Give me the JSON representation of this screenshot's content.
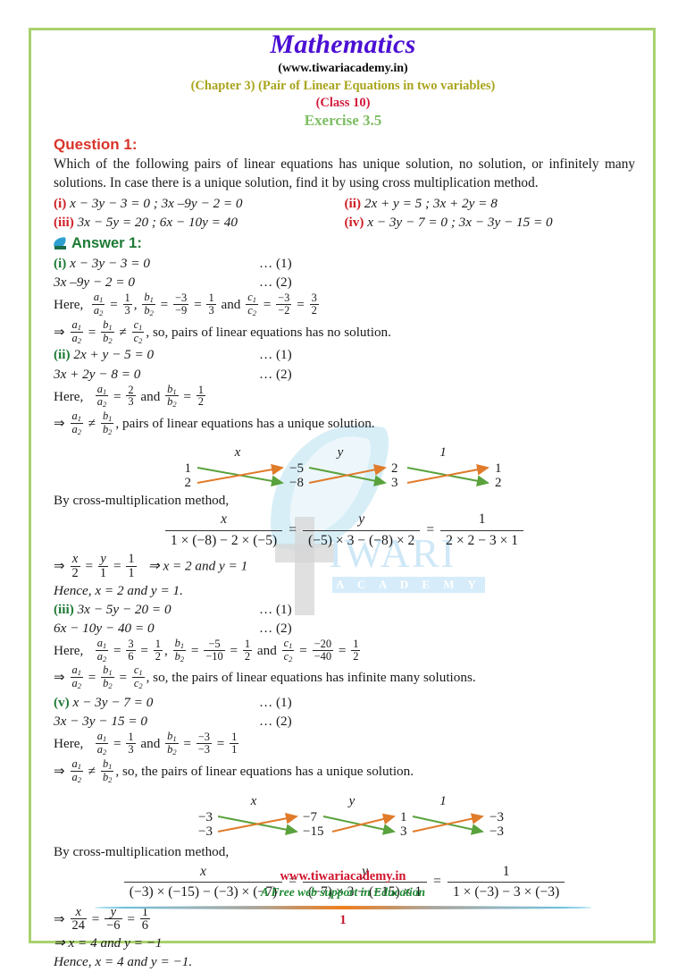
{
  "header": {
    "title": "Mathematics",
    "site": "(www.tiwariacademy.in)",
    "chapter": "(Chapter 3) (Pair of Linear Equations in two variables)",
    "class": "(Class 10)",
    "exercise": "Exercise 3.5"
  },
  "colors": {
    "title_purple": "#4b0fd4",
    "chapter_olive": "#a9a41d",
    "class_crimson": "#d21c3c",
    "exercise_green": "#7dbd63",
    "question_red": "#d9342b",
    "label_red": "#cf2027",
    "label_green": "#1e7a35",
    "border_green": "#a8d26d",
    "arrow_green": "#5aa23c",
    "arrow_orange": "#e07b2a",
    "watermark_blue": "#cfe8f7"
  },
  "question": {
    "heading": "Question 1:",
    "text": "Which of the following pairs of linear equations has unique solution, no solution, or infinitely many solutions. In case there is a unique solution, find it by using cross multiplication method.",
    "items": [
      {
        "label": "(i)",
        "equation": "x − 3y − 3  = 0 ; 3x –9y − 2  = 0"
      },
      {
        "label": "(ii)",
        "equation": "2x + y = 5 ; 3x + 2y = 8"
      },
      {
        "label": "(iii)",
        "equation": "3x − 5y = 20 ;   6x − 10y = 40"
      },
      {
        "label": "(iv)",
        "equation": "x − 3y − 7 = 0 ; 3x − 3y − 15 = 0"
      }
    ]
  },
  "answer": {
    "heading": "Answer 1:",
    "icon": "feather-pen-icon"
  },
  "part_i": {
    "label": "(i)",
    "eq1": "x − 3y − 3 = 0",
    "eq1_ref": "… (1)",
    "eq2": "3x –9y − 2 = 0",
    "eq2_ref": "… (2)",
    "here_word": "Here,",
    "ratios": [
      {
        "num": "a",
        "nsub": "1",
        "den": "a",
        "dsub": "2",
        "values": [
          "1",
          "3"
        ]
      },
      {
        "num": "b",
        "nsub": "1",
        "den": "b",
        "dsub": "2",
        "values": [
          "−3",
          "−9",
          "1",
          "3"
        ]
      },
      {
        "num": "c",
        "nsub": "1",
        "den": "c",
        "dsub": "2",
        "values": [
          "−3",
          "−2",
          "3",
          "2"
        ]
      }
    ],
    "conclusion": ", so, pairs of linear equations has no solution."
  },
  "part_ii": {
    "label": "(ii)",
    "eq1": "2x + y − 5 = 0",
    "eq1_ref": "… (1)",
    "eq2": "3x + 2y − 8 = 0",
    "eq2_ref": "… (2)",
    "here_word": "Here,",
    "ratio_a": [
      "2",
      "3"
    ],
    "ratio_b": [
      "1",
      "2"
    ],
    "conclusion": ", pairs of linear equations has a unique solution.",
    "diagram": {
      "col_labels": [
        "x",
        "y",
        "1"
      ],
      "top_row": [
        "1",
        "−5",
        "2",
        "1"
      ],
      "bottom_row": [
        "2",
        "−8",
        "3",
        "2"
      ]
    },
    "method_text": "By cross-multiplication method,",
    "formula": {
      "n1": "x",
      "d1": "1 × (−8) − 2 × (−5)",
      "n2": "y",
      "d2": "(−5) × 3 − (−8) × 2",
      "n3": "1",
      "d3": "2 × 2 − 3 × 1"
    },
    "solve_line": {
      "x_den": "2",
      "y_den": "1",
      "one_den": "1",
      "result": "⇒ x = 2   and   y = 1"
    },
    "hence": "Hence, x = 2  and  y = 1."
  },
  "part_iii": {
    "label": "(iii)",
    "eq1": "3x − 5y − 20 = 0",
    "eq1_ref": "… (1)",
    "eq2": "6x − 10y − 40 = 0",
    "eq2_ref": "… (2)",
    "here_word": "Here,",
    "ratio_a": [
      "3",
      "6",
      "1",
      "2"
    ],
    "ratio_b": [
      "−5",
      "−10",
      "1",
      "2"
    ],
    "ratio_c": [
      "−20",
      "−40",
      "1",
      "2"
    ],
    "conclusion": ", so, the pairs of linear equations has infinite many solutions."
  },
  "part_v": {
    "label": "(v)",
    "eq1": "x − 3y − 7 = 0",
    "eq1_ref": "… (1)",
    "eq2": "3x − 3y − 15 = 0",
    "eq2_ref": "… (2)",
    "here_word": "Here,",
    "ratio_a": [
      "1",
      "3"
    ],
    "ratio_b": [
      "−3",
      "−3",
      "1",
      "1"
    ],
    "conclusion": ", so, the pairs of linear equations has a unique solution.",
    "diagram": {
      "col_labels": [
        "x",
        "y",
        "1"
      ],
      "top_row": [
        "−3",
        "−7",
        "1",
        "−3"
      ],
      "bottom_row": [
        "−3",
        "−15",
        "3",
        "−3"
      ]
    },
    "method_text": "By cross-multiplication method,",
    "formula": {
      "n1": "x",
      "d1": "(−3) × (−15) − (−3) × (−7)",
      "n2": "y",
      "d2": "(−7) × 3 − (−15) × 1",
      "n3": "1",
      "d3": "1 × (−3) − 3 × (−3)"
    },
    "solve_line": {
      "x_den": "24",
      "y_den": "−6",
      "one_den": "6"
    },
    "result": "⇒ x = 4   and   y = −1",
    "hence": "Hence, x = 4 and  y = −1."
  },
  "watermark": {
    "brand": "IWARI",
    "sub": "A C A D E M Y"
  },
  "footer": {
    "site": "www.tiwariacademy.in",
    "tagline": "A Free web support in Education",
    "page_number": "1"
  }
}
